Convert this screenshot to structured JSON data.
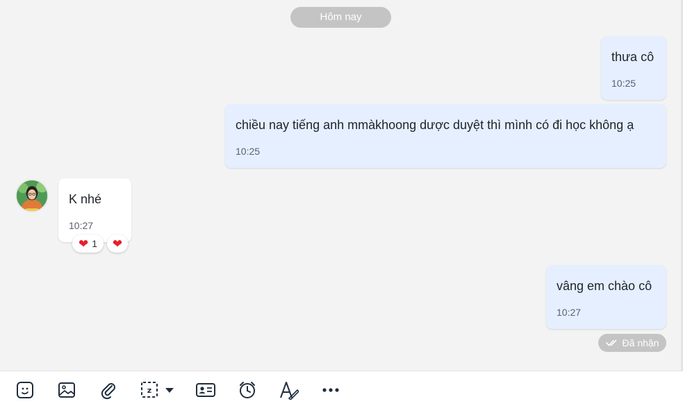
{
  "date_separator": "Hôm nay",
  "messages": [
    {
      "direction": "out",
      "text": "thưa cô",
      "time": "10:25"
    },
    {
      "direction": "out",
      "text": "chiều nay tiếng anh mmàkhoong dược duyệt thì mình có đi học không ạ",
      "time": "10:25"
    },
    {
      "direction": "in",
      "text": "K nhé",
      "time": "10:27",
      "reactions": {
        "count": "1"
      }
    },
    {
      "direction": "out",
      "text": "vâng em chào cô",
      "time": "10:27"
    }
  ],
  "status": "Đã nhận",
  "colors": {
    "outgoing_bubble": "#e5efff",
    "incoming_bubble": "#ffffff",
    "heart": "#e8202a",
    "pill": "#c4c4c4"
  },
  "toolbar_icons": [
    "sticker-icon",
    "image-icon",
    "attachment-icon",
    "screenshot-icon",
    "contact-card-icon",
    "reminder-icon",
    "text-format-icon",
    "more-icon"
  ]
}
